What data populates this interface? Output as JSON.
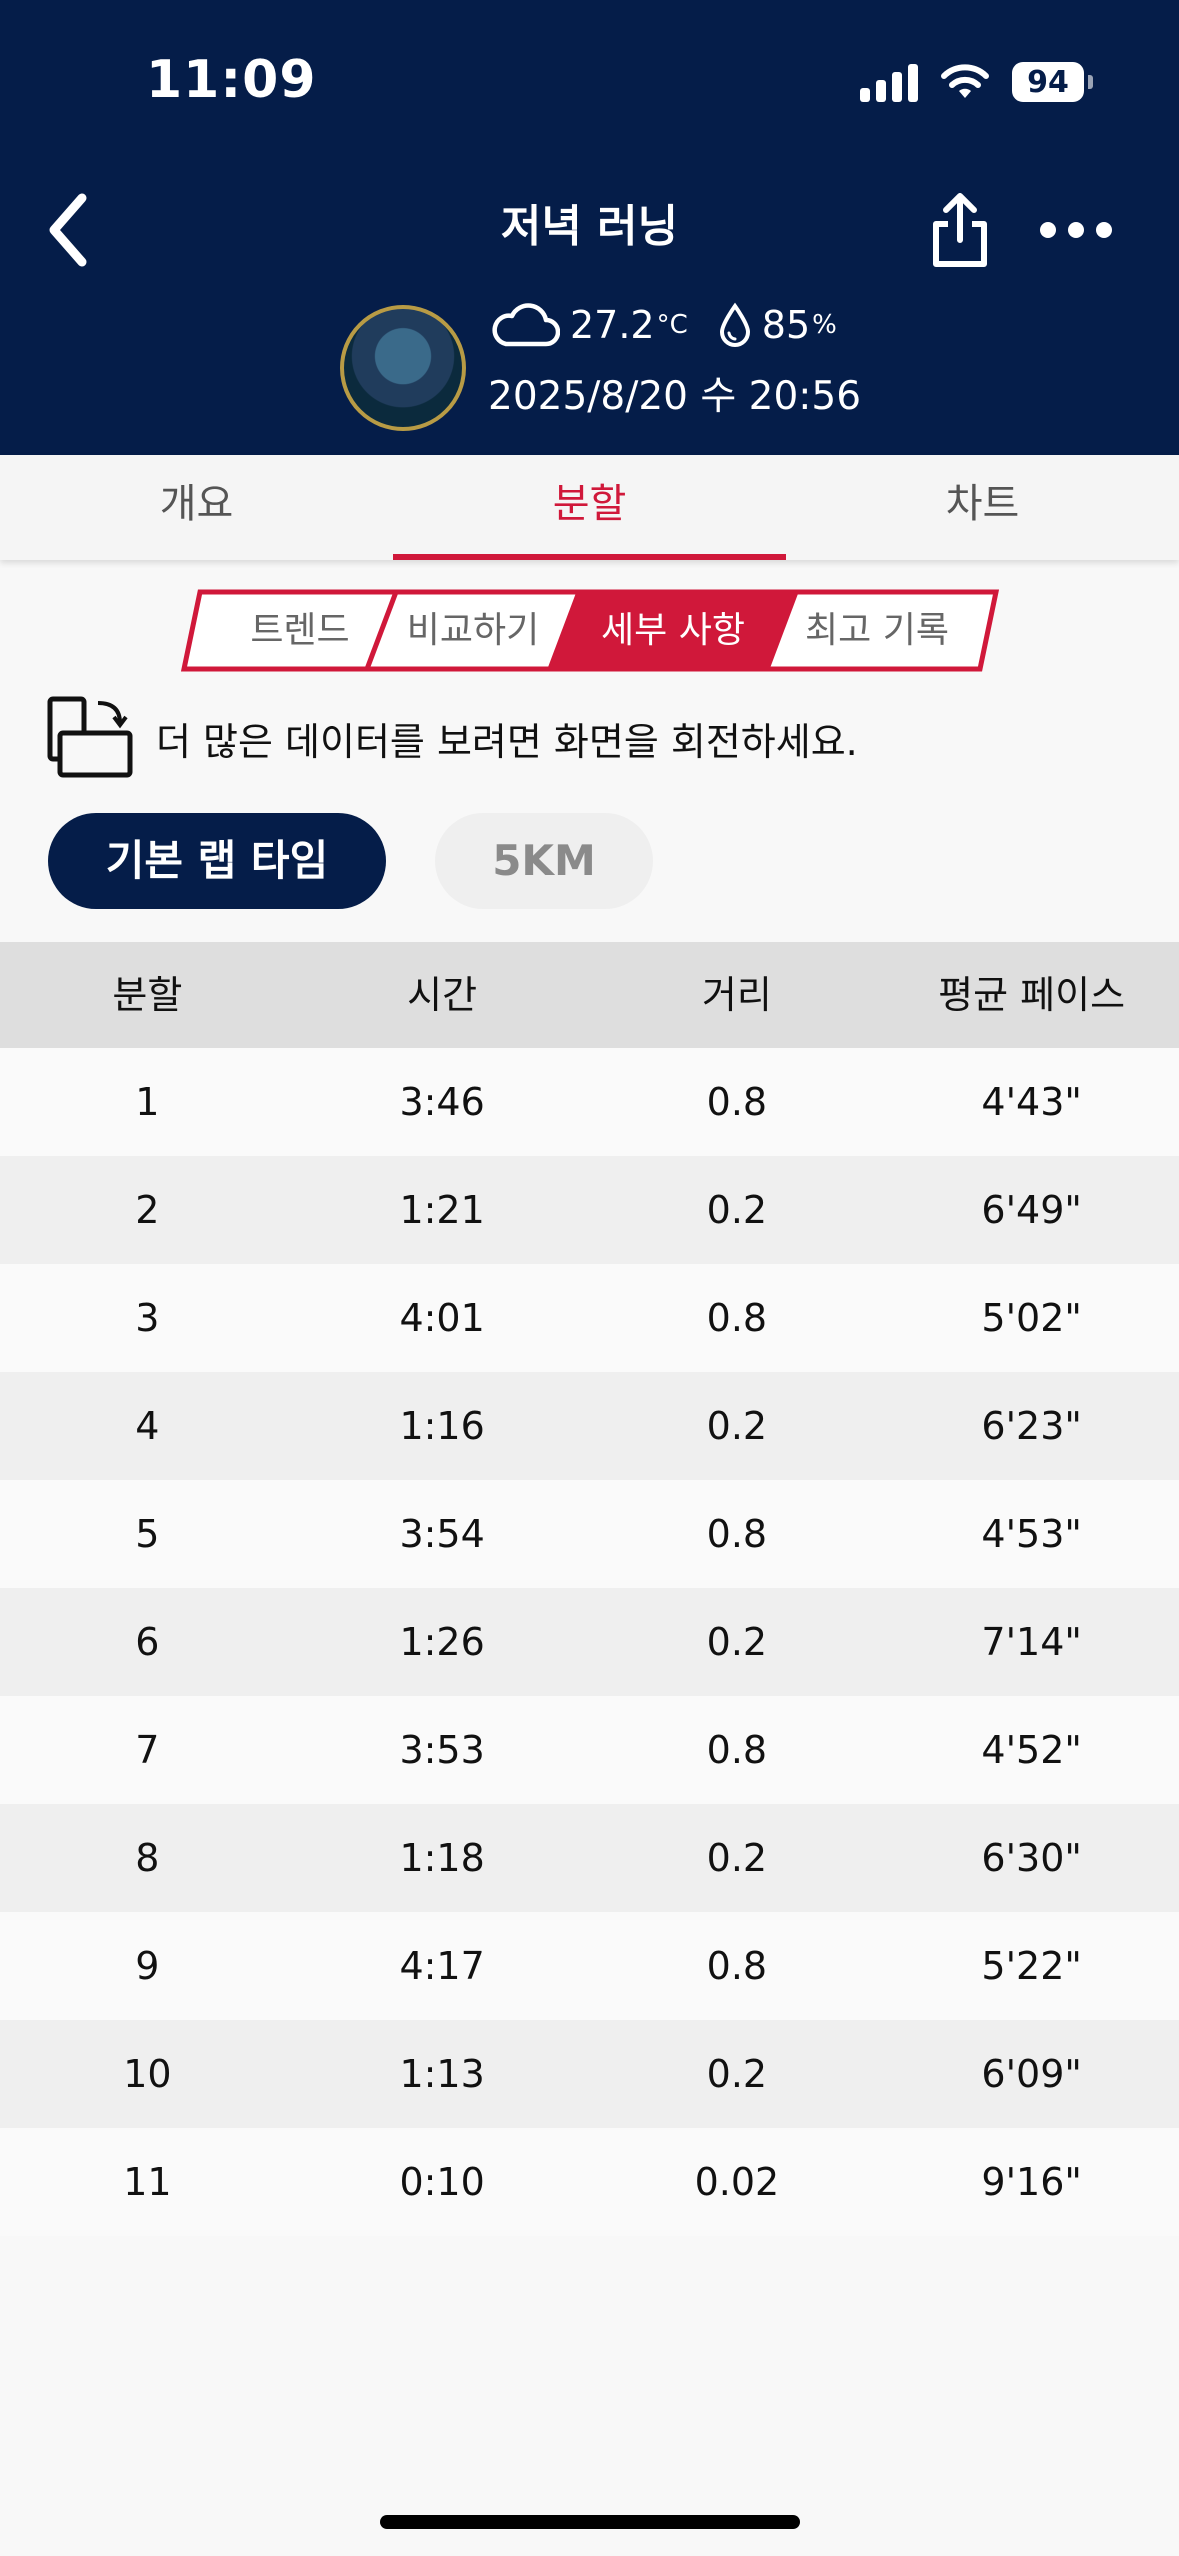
{
  "status": {
    "time": "11:09",
    "battery": "94"
  },
  "header": {
    "title": "저녁 러닝",
    "temperature": "27.2",
    "temp_unit": "°C",
    "humidity": "85",
    "humidity_unit": "%",
    "datetime": "2025/8/20 수 20:56"
  },
  "tabs": [
    {
      "label": "개요",
      "active": false
    },
    {
      "label": "분할",
      "active": true
    },
    {
      "label": "차트",
      "active": false
    }
  ],
  "segments": [
    {
      "label": "트렌드",
      "active": false
    },
    {
      "label": "비교하기",
      "active": false
    },
    {
      "label": "세부 사항",
      "active": true
    },
    {
      "label": "최고 기록",
      "active": false
    }
  ],
  "rotate_hint": "더 많은 데이터를 보려면 화면을 회전하세요.",
  "filters": {
    "basic_lap": "기본 랩 타임",
    "five_km": "5KM"
  },
  "table": {
    "headers": [
      "분할",
      "시간",
      "거리",
      "평균 페이스"
    ],
    "rows": [
      [
        "1",
        "3:46",
        "0.8",
        "4'43\""
      ],
      [
        "2",
        "1:21",
        "0.2",
        "6'49\""
      ],
      [
        "3",
        "4:01",
        "0.8",
        "5'02\""
      ],
      [
        "4",
        "1:16",
        "0.2",
        "6'23\""
      ],
      [
        "5",
        "3:54",
        "0.8",
        "4'53\""
      ],
      [
        "6",
        "1:26",
        "0.2",
        "7'14\""
      ],
      [
        "7",
        "3:53",
        "0.8",
        "4'52\""
      ],
      [
        "8",
        "1:18",
        "0.2",
        "6'30\""
      ],
      [
        "9",
        "4:17",
        "0.8",
        "5'22\""
      ],
      [
        "10",
        "1:13",
        "0.2",
        "6'09\""
      ],
      [
        "11",
        "0:10",
        "0.02",
        "9'16\""
      ]
    ]
  },
  "colors": {
    "navy": "#051d49",
    "accent": "#d0183a"
  }
}
